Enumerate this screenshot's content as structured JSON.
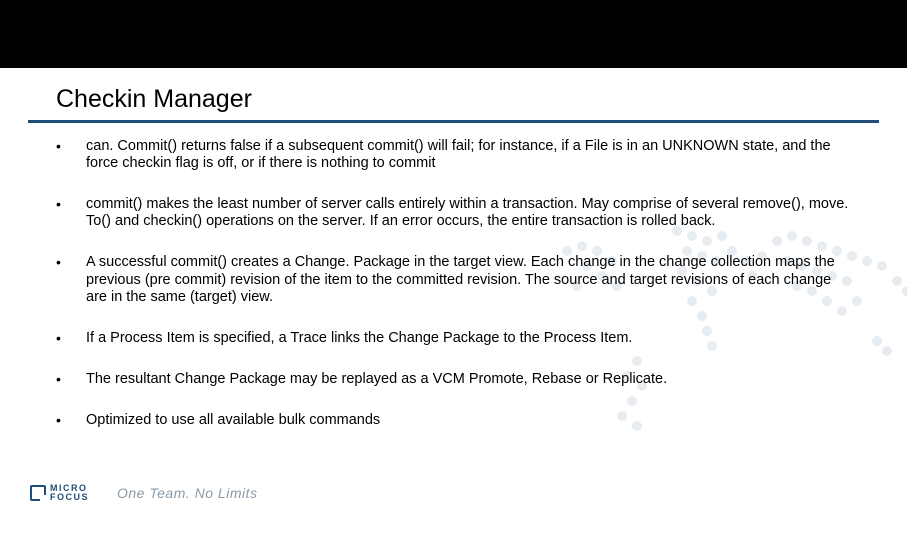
{
  "title": "Checkin Manager",
  "bullets": [
    "can. Commit() returns false if a subsequent commit() will fail; for instance, if a File is in an UNKNOWN state, and the force checkin flag is off, or if there is nothing to commit",
    "commit() makes the least number of server calls entirely within a transaction. May comprise of several remove(), move. To() and checkin() operations on the server. If an error occurs, the entire transaction is rolled back.",
    "A successful commit() creates a Change. Package in the target view. Each change in the change collection maps the previous (pre commit) revision of the item to the committed revision. The source and target revisions of each change are in the same (target) view.",
    "If a Process Item is specified, a Trace links the Change Package to the Process Item.",
    "The resultant Change Package may be replayed as a VCM Promote, Rebase or Replicate.",
    "Optimized to use all available bulk commands"
  ],
  "footer": {
    "logo_line1": "MICRO",
    "logo_line2": "FOCUS",
    "tagline": "One Team. No Limits"
  },
  "colors": {
    "band": "#000000",
    "rule": "#1f4e79",
    "brand": "#1f4e79",
    "tagline": "#8a9aa8"
  }
}
